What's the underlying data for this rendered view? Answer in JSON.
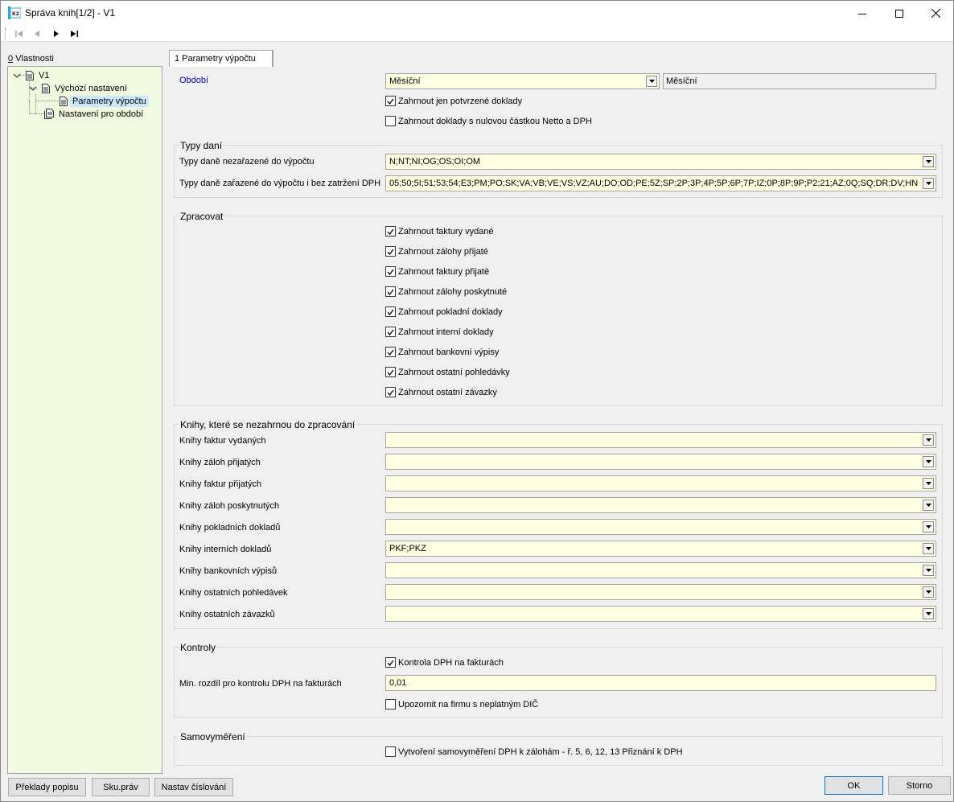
{
  "window": {
    "title": "Správa knih[1/2] - V1",
    "icon": "k2-app-icon",
    "controls": [
      "minimize-icon",
      "maximize-icon",
      "close-icon"
    ]
  },
  "nav": [
    "first-record-icon",
    "previous-record-icon",
    "next-record-icon",
    "last-record-icon"
  ],
  "left": {
    "label_key": "0",
    "label_rest": " Vlastnosti",
    "tree": [
      {
        "label": "V1"
      },
      {
        "label": "Výchozí nastavení"
      },
      {
        "label": "Parametry výpočtu",
        "selected": true
      },
      {
        "label": "Nastavení pro období"
      }
    ]
  },
  "tab": {
    "label": "1 Parametry výpočtu"
  },
  "form": {
    "obdobi": {
      "label": "Období",
      "value": "Měsíční",
      "readonly": "Měsíční"
    },
    "top_checks": [
      {
        "label": "Zahrnout jen potvrzené doklady",
        "checked": true
      },
      {
        "label": "Zahrnout doklady s nulovou částkou Netto a DPH",
        "checked": false
      }
    ],
    "typy_dani": {
      "title": "Typy daní",
      "rows": [
        {
          "label": "Typy daně nezařazené do výpočtu",
          "value": "N;NT;NI;OG;OS;OI;OM"
        },
        {
          "label": "Typy daně zařazené do výpočtu i bez zatržení DPH",
          "value": "05;50;5I;51;53;54;E3;PM;PO;SK;VA;VB;VE;VS;VZ;AU;DO;OD;PE;5Z;SP;2P;3P;4P;5P;6P;7P;IZ;0P;8P;9P;P2;21;AZ;0Q;SQ;DR;DV;HN"
        }
      ]
    },
    "zpracovat": {
      "title": "Zpracovat",
      "items": [
        {
          "label": "Zahrnout faktury vydané",
          "checked": true
        },
        {
          "label": "Zahrnout zálohy přijaté",
          "checked": true
        },
        {
          "label": "Zahrnout faktury přijaté",
          "checked": true
        },
        {
          "label": "Zahrnout zálohy poskytnuté",
          "checked": true
        },
        {
          "label": "Zahrnout pokladní doklady",
          "checked": true
        },
        {
          "label": "Zahrnout interní doklady",
          "checked": true
        },
        {
          "label": "Zahrnout bankovní výpisy",
          "checked": true
        },
        {
          "label": "Zahrnout ostatní pohledávky",
          "checked": true
        },
        {
          "label": "Zahrnout ostatní závazky",
          "checked": true
        }
      ]
    },
    "knihy": {
      "title": "Knihy, které se nezahrnou do zpracování",
      "rows": [
        {
          "label": "Knihy faktur vydaných",
          "value": ""
        },
        {
          "label": "Knihy záloh přijatých",
          "value": ""
        },
        {
          "label": "Knihy faktur přijatých",
          "value": ""
        },
        {
          "label": "Knihy záloh poskytnutých",
          "value": ""
        },
        {
          "label": "Knihy pokladních dokladů",
          "value": ""
        },
        {
          "label": "Knihy interních dokladů",
          "value": "PKF;PKZ"
        },
        {
          "label": "Knihy bankovních výpisů",
          "value": ""
        },
        {
          "label": "Knihy ostatních pohledávek",
          "value": ""
        },
        {
          "label": "Knihy ostatních závazků",
          "value": ""
        }
      ]
    },
    "kontroly": {
      "title": "Kontroly",
      "check1": {
        "label": "Kontrola DPH na fakturách",
        "checked": true
      },
      "min_label": "Min. rozdíl pro kontrolu DPH na fakturách",
      "min_value": "0,01",
      "check2": {
        "label": "Upozornit na firmu s neplatným DIČ",
        "checked": false
      }
    },
    "samovymereni": {
      "title": "Samovyměření",
      "check": {
        "label": "Vytvoření samovyměření DPH k zálohám - ř. 5, 6, 12, 13 Přiznání k DPH",
        "checked": false
      }
    }
  },
  "bottom": {
    "left_buttons": [
      "Překlady popisu",
      "Sku.práv",
      "Nastav číslování"
    ],
    "ok": "OK",
    "cancel": "Storno"
  },
  "colors": {
    "input_bg": "#ffffe1",
    "tree_bg": "#f2fae0",
    "selection": "#cce8ff",
    "field_label_blue": "#0000cc"
  }
}
